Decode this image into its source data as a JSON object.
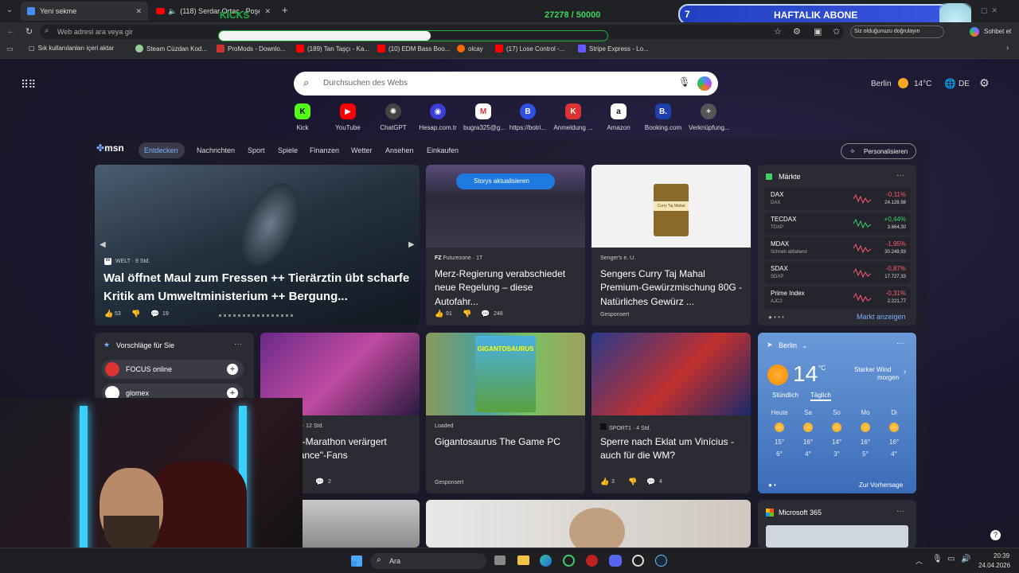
{
  "tabs": [
    {
      "label": "Yeni sekme"
    },
    {
      "label": "(118) Serdar Ortaç - Poşet - Yo"
    }
  ],
  "address": {
    "placeholder": "Web adresi ara veya gir"
  },
  "overlay": {
    "kicks": "KICKS",
    "counter": "27278 / 50000",
    "goal_num": "7",
    "goal_label": "HAFTALIK ABONE"
  },
  "browser_right": {
    "verify": "Siz olduğunuzu doğrulayın",
    "chat": "Sohbet et"
  },
  "bookmarks": [
    "Sık kullanılanları içeri aktar",
    "Steam Cüzdan Kod...",
    "ProMods - Downlo...",
    "(189) Tan Taşçı - Ka...",
    "(10) EDM Bass Boo...",
    "olcay",
    "(17) Lose Control -...",
    "Stripe Express - Lo..."
  ],
  "search": {
    "placeholder": "Durchsuchen des Webs"
  },
  "header_right": {
    "city": "Berlin",
    "temp": "14°C",
    "lang": "DE"
  },
  "shortcuts": [
    "Kick",
    "YouTube",
    "ChatGPT",
    "Hesap.com.tr",
    "bugra325@g...",
    "https://botri...",
    "Anmeldung ...",
    "Amazon",
    "Booking.com",
    "Verknüpfung..."
  ],
  "nav": {
    "logo": "msn",
    "items": [
      "Entdecken",
      "Nachrichten",
      "Sport",
      "Spiele",
      "Finanzen",
      "Wetter",
      "Ansehen",
      "Einkaufen"
    ],
    "personalize": "Personalisieren"
  },
  "hero": {
    "source": "WELT · 9 Std.",
    "title": "Wal öffnet Maul zum Fressen ++ Tierärztin übt scharfe Kritik am Umweltministerium ++ Bergung...",
    "likes": "53",
    "comments": "19"
  },
  "story2": {
    "badge": "Storys aktualisieren",
    "source": "Futurezone · 1T",
    "title": "Merz-Regierung verabschiedet neue Regelung – diese Autofahr...",
    "likes": "91",
    "comments": "248"
  },
  "story3": {
    "source": "Senger's e. U.",
    "title": "Sengers Curry Taj Mahal Premium-Gewürzmischung 80G - Natürliches Gewürz ...",
    "ad": "Gesponsert",
    "jar_label": "Curry Taj Mahal"
  },
  "markets": {
    "title": "Märkte",
    "rows": [
      {
        "name": "DAX",
        "sub": "DAX",
        "change": "-0,11%",
        "value": "24.128,98",
        "up": false
      },
      {
        "name": "TECDAX",
        "sub": "TDXP",
        "change": "+0,44%",
        "value": "3.664,30",
        "up": true
      },
      {
        "name": "MDAX",
        "sub": "Schnell abfallend",
        "change": "-1,95%",
        "value": "30.249,93",
        "up": false
      },
      {
        "name": "SDAX",
        "sub": "SDXP",
        "change": "-0,87%",
        "value": "17.727,33",
        "up": false
      },
      {
        "name": "Prime Index",
        "sub": "AJC2",
        "change": "-0,31%",
        "value": "2.221,77",
        "up": false
      }
    ],
    "link": "Markt anzeigen"
  },
  "suggest": {
    "title": "Vorschläge für Sie",
    "items": [
      "FOCUS online",
      "glomex"
    ]
  },
  "story4": {
    "source": "film · 12 Std.",
    "title": "ex-Marathon verärgert Dance\"-Fans",
    "comments": "2"
  },
  "story5": {
    "source": "Loaded",
    "title": "Gigantosaurus The Game PC",
    "ad": "Gesponsert",
    "art": "GIGANTOSAURUS"
  },
  "story6": {
    "source": "SPORT1 · 4 Std.",
    "title": "Sperre nach Eklat um Vinícius - auch für die WM?",
    "likes": "3",
    "comments": "4"
  },
  "weather": {
    "city": "Berlin",
    "temp": "14",
    "unit": "°C",
    "desc1": "Starker Wind",
    "desc2": "morgen",
    "tab1": "Stündlich",
    "tab2": "Täglich",
    "days": [
      {
        "d": "Heute",
        "hi": "15°",
        "lo": "6°"
      },
      {
        "d": "Sa",
        "hi": "16°",
        "lo": "4°"
      },
      {
        "d": "So",
        "hi": "14°",
        "lo": "3°"
      },
      {
        "d": "Mo",
        "hi": "16°",
        "lo": "5°"
      },
      {
        "d": "Di",
        "hi": "16°",
        "lo": "4°"
      }
    ],
    "link": "Zur Vorhersage"
  },
  "m365": {
    "title": "Microsoft 365"
  },
  "taskbar": {
    "search": "Ara",
    "time": "20:39",
    "date": "24.04.2026"
  },
  "colors": {
    "accent": "#4b8cf5",
    "msn_blue": "#1c6fe0",
    "up": "#3ecf6a",
    "down": "#ff5a6e"
  }
}
